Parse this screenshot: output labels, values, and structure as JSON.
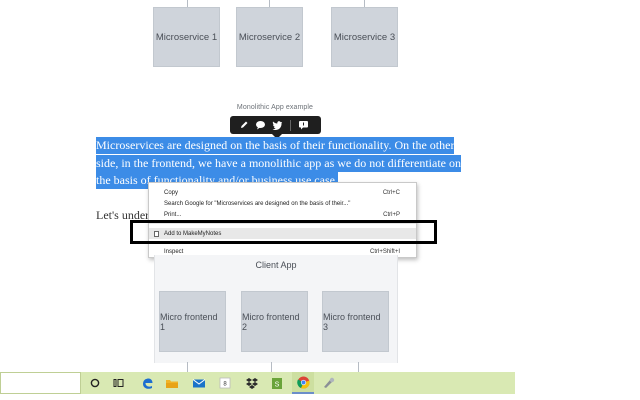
{
  "diagram_top": {
    "services": [
      "Microservice 1",
      "Microservice 2",
      "Microservice 3"
    ],
    "caption": "Monolithic App example"
  },
  "toolbar": {
    "icons": [
      "pencil-icon",
      "comment-icon",
      "twitter-icon",
      "note-icon"
    ]
  },
  "article": {
    "selected_lines": [
      "Microservices are designed on the basis of their functionality. On the other",
      "side, in the frontend, we have a monolithic app as we do not differentiate on",
      "the basis of functionality and/or business use case."
    ],
    "next_line": "Let's under"
  },
  "context_menu": {
    "copy": "Copy",
    "copy_shortcut": "Ctrl+C",
    "search_google": "Search Google for \"Microservices are designed on the basis of their...\"",
    "print": "Print...",
    "print_shortcut": "Ctrl+P",
    "add_note": "Add to MakeMyNotes",
    "inspect": "Inspect",
    "inspect_shortcut": "Ctrl+Shift+I"
  },
  "diagram_bottom": {
    "title": "Client App",
    "frontends": [
      "Micro frontend 1",
      "Micro frontend 2",
      "Micro frontend 3"
    ]
  },
  "taskbar": {
    "icons": [
      "cortana-icon",
      "task-view-icon",
      "edge-icon",
      "file-explorer-icon",
      "mail-icon",
      "app-icon",
      "dropbox-icon",
      "green-app-icon",
      "chrome-icon",
      "tool-icon"
    ],
    "colors": {
      "bar": "#d9e9b3",
      "selection": "#3c8ce7"
    }
  }
}
